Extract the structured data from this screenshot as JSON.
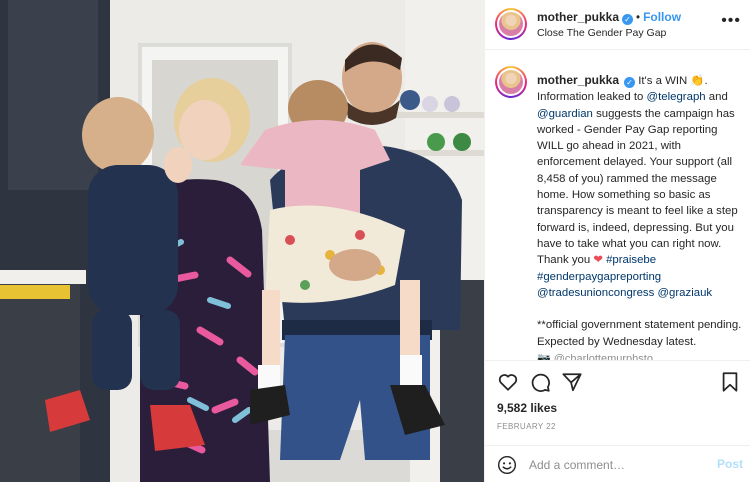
{
  "photo": {
    "description_icon": "family-hug-photo"
  },
  "header": {
    "username": "mother_pukka",
    "verified_icon": "verified-badge-icon",
    "separator": "•",
    "follow_label": "Follow",
    "location": "Close The Gender Pay Gap",
    "more_label": "•••"
  },
  "caption": {
    "username": "mother_pukka",
    "text_1": "It's a WIN 👏. Information leaked to ",
    "mention_telegraph": "@telegraph",
    "text_2": " and ",
    "mention_guardian": "@guardian",
    "text_3": " suggests the campaign has worked - Gender Pay Gap reporting WILL go ahead in 2021, with enforcement delayed. Your support (all 8,458 of you) rammed the message home. How something so basic as transparency is meant to feel like a step forward is, indeed, depressing. But you have to take what you can right now. Thank you ",
    "heart": "❤",
    "hashtag_praisebe": "#praisebe",
    "hashtag_gpg": "#genderpaygapreporting",
    "mention_tuc": "@tradesunioncongress",
    "mention_grazia": "@graziauk",
    "text_4": "**official government statement pending. Expected by Wednesday latest.",
    "cut_text": "📷 @charlottemurphsto"
  },
  "actions": {
    "like_icon": "heart-outline-icon",
    "comment_icon": "comment-bubble-icon",
    "share_icon": "share-paper-plane-icon",
    "save_icon": "bookmark-icon",
    "likes": "9,582 likes",
    "date": "FEBRUARY 22"
  },
  "comment_box": {
    "emoji_icon": "smiley-face-icon",
    "placeholder": "Add a comment…",
    "post_label": "Post"
  },
  "colors": {
    "link": "#00376b",
    "follow": "#3897f0",
    "post_disabled": "#b2dffc",
    "heart": "#ed4956"
  }
}
